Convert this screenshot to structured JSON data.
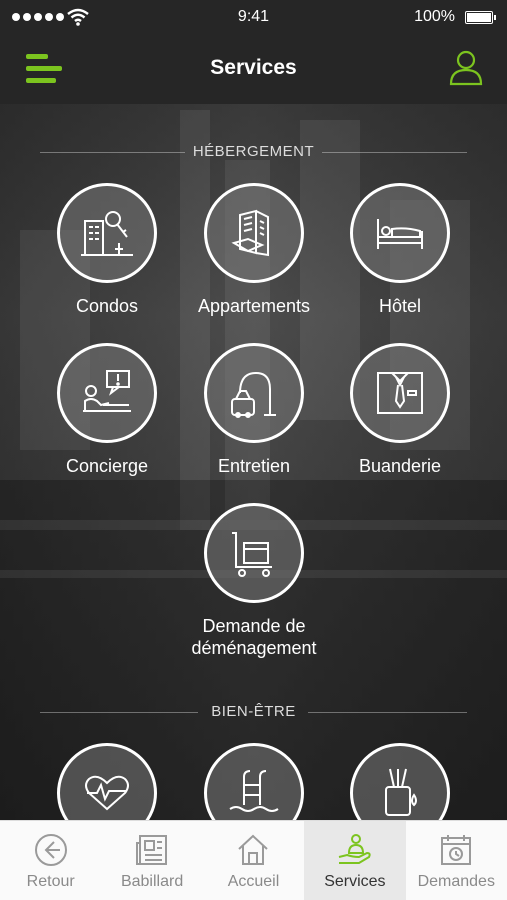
{
  "status": {
    "time": "9:41",
    "battery": "100%"
  },
  "header": {
    "title": "Services",
    "menu_icon": "menu-icon",
    "profile_icon": "user-icon"
  },
  "accent_color": "#7cc41f",
  "sections": [
    {
      "label": "HÉBERGEMENT",
      "items": [
        {
          "label": "Condos",
          "icon": "condo-key-icon"
        },
        {
          "label": "Appartements",
          "icon": "apartment-building-icon"
        },
        {
          "label": "Hôtel",
          "icon": "hotel-bed-icon"
        },
        {
          "label": "Concierge",
          "icon": "concierge-desk-icon"
        },
        {
          "label": "Entretien",
          "icon": "vacuum-cleaner-icon"
        },
        {
          "label": "Buanderie",
          "icon": "laundry-shirt-icon"
        },
        {
          "label": "Demande de déménagement",
          "icon": "moving-cart-icon"
        }
      ]
    },
    {
      "label": "BIEN-ÊTRE",
      "items": [
        {
          "label": "",
          "icon": "heart-dumbbell-icon"
        },
        {
          "label": "",
          "icon": "pool-ladder-icon"
        },
        {
          "label": "",
          "icon": "spa-diffuser-icon"
        }
      ]
    }
  ],
  "tabs": [
    {
      "label": "Retour",
      "icon": "back-arrow-icon",
      "active": false
    },
    {
      "label": "Babillard",
      "icon": "newspaper-icon",
      "active": false
    },
    {
      "label": "Accueil",
      "icon": "home-icon",
      "active": false
    },
    {
      "label": "Services",
      "icon": "services-hand-icon",
      "active": true
    },
    {
      "label": "Demandes",
      "icon": "calendar-clock-icon",
      "active": false
    }
  ]
}
